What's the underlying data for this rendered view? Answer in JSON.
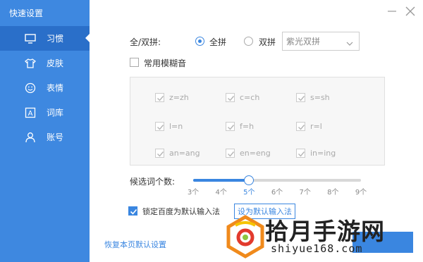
{
  "sidebar": {
    "title": "快速设置",
    "items": [
      {
        "label": "习惯",
        "icon": "monitor-icon",
        "active": true
      },
      {
        "label": "皮肤",
        "icon": "shirt-icon",
        "active": false
      },
      {
        "label": "表情",
        "icon": "smile-icon",
        "active": false
      },
      {
        "label": "词库",
        "icon": "dictionary-icon",
        "active": false
      },
      {
        "label": "账号",
        "icon": "user-icon",
        "active": false
      }
    ]
  },
  "window": {
    "minimize_icon": "minimize-icon",
    "close_icon": "close-icon"
  },
  "pinyin_mode": {
    "label": "全/双拼:",
    "option_full": "全拼",
    "option_double": "双拼",
    "selected": "全拼",
    "double_scheme": "紫光双拼"
  },
  "fuzzy": {
    "label": "常用模糊音",
    "checked": false,
    "items": [
      "z=zh",
      "c=ch",
      "s=sh",
      "l=n",
      "f=h",
      "r=l",
      "an=ang",
      "en=eng",
      "in=ing"
    ]
  },
  "candidates": {
    "label": "候选词个数:",
    "ticks": [
      "3个",
      "4个",
      "5个",
      "6个",
      "7个",
      "8个",
      "9个"
    ],
    "selected": "5个",
    "value": 5,
    "min": 3,
    "max": 9
  },
  "default_ime": {
    "checkbox_label": "锁定百度为默认输入法",
    "checked": true,
    "button_label": "设为默认输入法"
  },
  "footer": {
    "restore_label": "恢复本页默认设置"
  },
  "watermark": {
    "text": "拾月手游网",
    "url": "shiyue168.com"
  },
  "colors": {
    "sidebar": "#3e88e0",
    "sidebar_active": "#2a6fc9",
    "accent": "#3a86e0"
  }
}
